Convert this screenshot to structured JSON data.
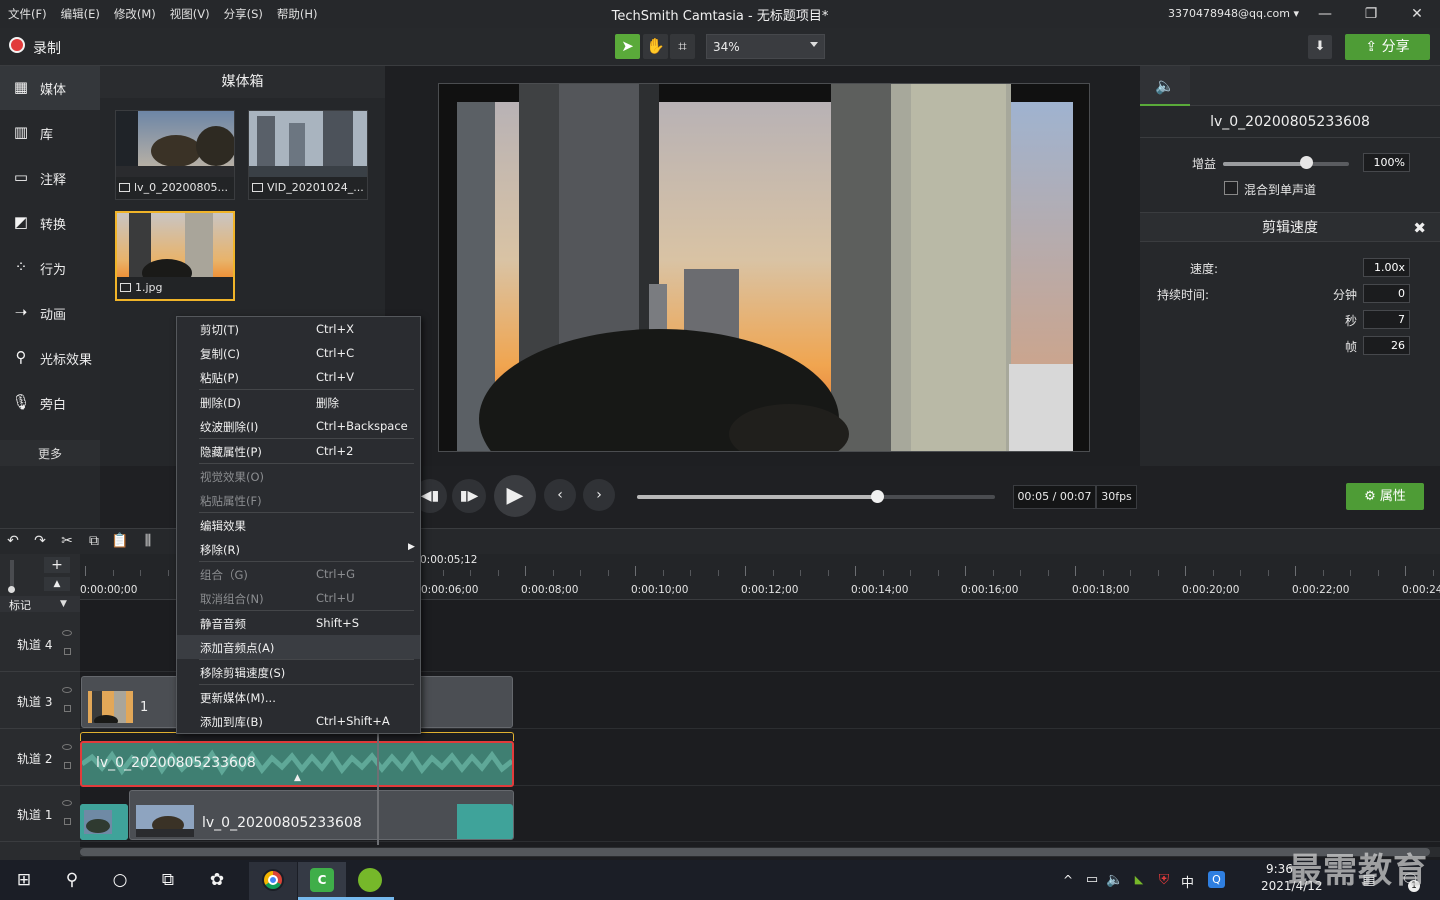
{
  "menubar": {
    "items": [
      "文件(F)",
      "编辑(E)",
      "修改(M)",
      "视图(V)",
      "分享(S)",
      "帮助(H)"
    ],
    "title": "TechSmith Camtasia - 无标题项目*",
    "account": "3370478948@qq.com"
  },
  "toolbar": {
    "record_label": "录制",
    "zoom": "34%",
    "share_label": "分享"
  },
  "sidebar": {
    "items": [
      {
        "label": "媒体",
        "icon": "media-icon"
      },
      {
        "label": "库",
        "icon": "library-icon"
      },
      {
        "label": "注释",
        "icon": "annotation-icon"
      },
      {
        "label": "转换",
        "icon": "transition-icon"
      },
      {
        "label": "行为",
        "icon": "behavior-icon"
      },
      {
        "label": "动画",
        "icon": "animation-icon"
      },
      {
        "label": "光标效果",
        "icon": "cursor-effect-icon"
      },
      {
        "label": "旁白",
        "icon": "microphone-icon"
      }
    ],
    "more_label": "更多"
  },
  "media_bin": {
    "title": "媒体箱",
    "items": [
      {
        "name": "lv_0_20200805...",
        "type": "video"
      },
      {
        "name": "VID_20201024_...",
        "type": "video"
      },
      {
        "name": "1.jpg",
        "type": "image"
      }
    ]
  },
  "properties": {
    "clip_name": "lv_0_20200805233608",
    "gain_label": "增益",
    "gain_value": "100%",
    "gain_fraction": 0.66,
    "mono_label": "混合到单声道",
    "speed_section": "剪辑速度",
    "speed_label": "速度:",
    "speed_value": "1.00x",
    "duration_label": "持续时间:",
    "minutes_label": "分钟",
    "minutes_value": "0",
    "seconds_label": "秒",
    "seconds_value": "7",
    "frames_label": "帧",
    "frames_value": "26"
  },
  "playback": {
    "time": "00:05 / 00:07",
    "fps": "30fps",
    "progress": 0.67,
    "properties_label": "属性"
  },
  "timeline": {
    "playhead": "0:00:05;12",
    "ruler": [
      "0:00:00;00",
      "0:00:06;00",
      "0:00:08;00",
      "0:00:10;00",
      "0:00:12;00",
      "0:00:14;00",
      "0:00:16;00",
      "0:00:18;00",
      "0:00:20;00",
      "0:00:22;00",
      "0:00:24"
    ],
    "marker_label": "标记",
    "tracks": [
      "轨道 4",
      "轨道 3",
      "轨道 2",
      "轨道 1"
    ],
    "clip_track3": "1",
    "clip_track2": "lv_0_20200805233608",
    "clip_track1": "lv_0_20200805233608"
  },
  "context_menu": {
    "items": [
      {
        "label": "剪切(T)",
        "shortcut": "Ctrl+X"
      },
      {
        "label": "复制(C)",
        "shortcut": "Ctrl+C"
      },
      {
        "label": "粘贴(P)",
        "shortcut": "Ctrl+V"
      },
      {
        "label": "删除(D)",
        "shortcut": "删除"
      },
      {
        "label": "纹波删除(I)",
        "shortcut": "Ctrl+Backspace"
      },
      {
        "label": "隐藏属性(P)",
        "shortcut": "Ctrl+2"
      },
      {
        "label": "视觉效果(O)",
        "shortcut": ""
      },
      {
        "label": "粘贴属性(F)",
        "shortcut": ""
      },
      {
        "label": "编辑效果",
        "shortcut": ""
      },
      {
        "label": "移除(R)",
        "shortcut": ""
      },
      {
        "label": "组合（G)",
        "shortcut": "Ctrl+G"
      },
      {
        "label": "取消组合(N)",
        "shortcut": "Ctrl+U"
      },
      {
        "label": "静音音频",
        "shortcut": "Shift+S"
      },
      {
        "label": "添加音频点(A)",
        "shortcut": ""
      },
      {
        "label": "移除剪辑速度(S)",
        "shortcut": ""
      },
      {
        "label": "更新媒体(M)...",
        "shortcut": ""
      },
      {
        "label": "添加到库(B)",
        "shortcut": "Ctrl+Shift+A"
      }
    ]
  },
  "taskbar": {
    "time": "9:36",
    "date": "2021/4/12",
    "ime": "中",
    "notif_count": "1"
  },
  "watermark": "最需教育"
}
